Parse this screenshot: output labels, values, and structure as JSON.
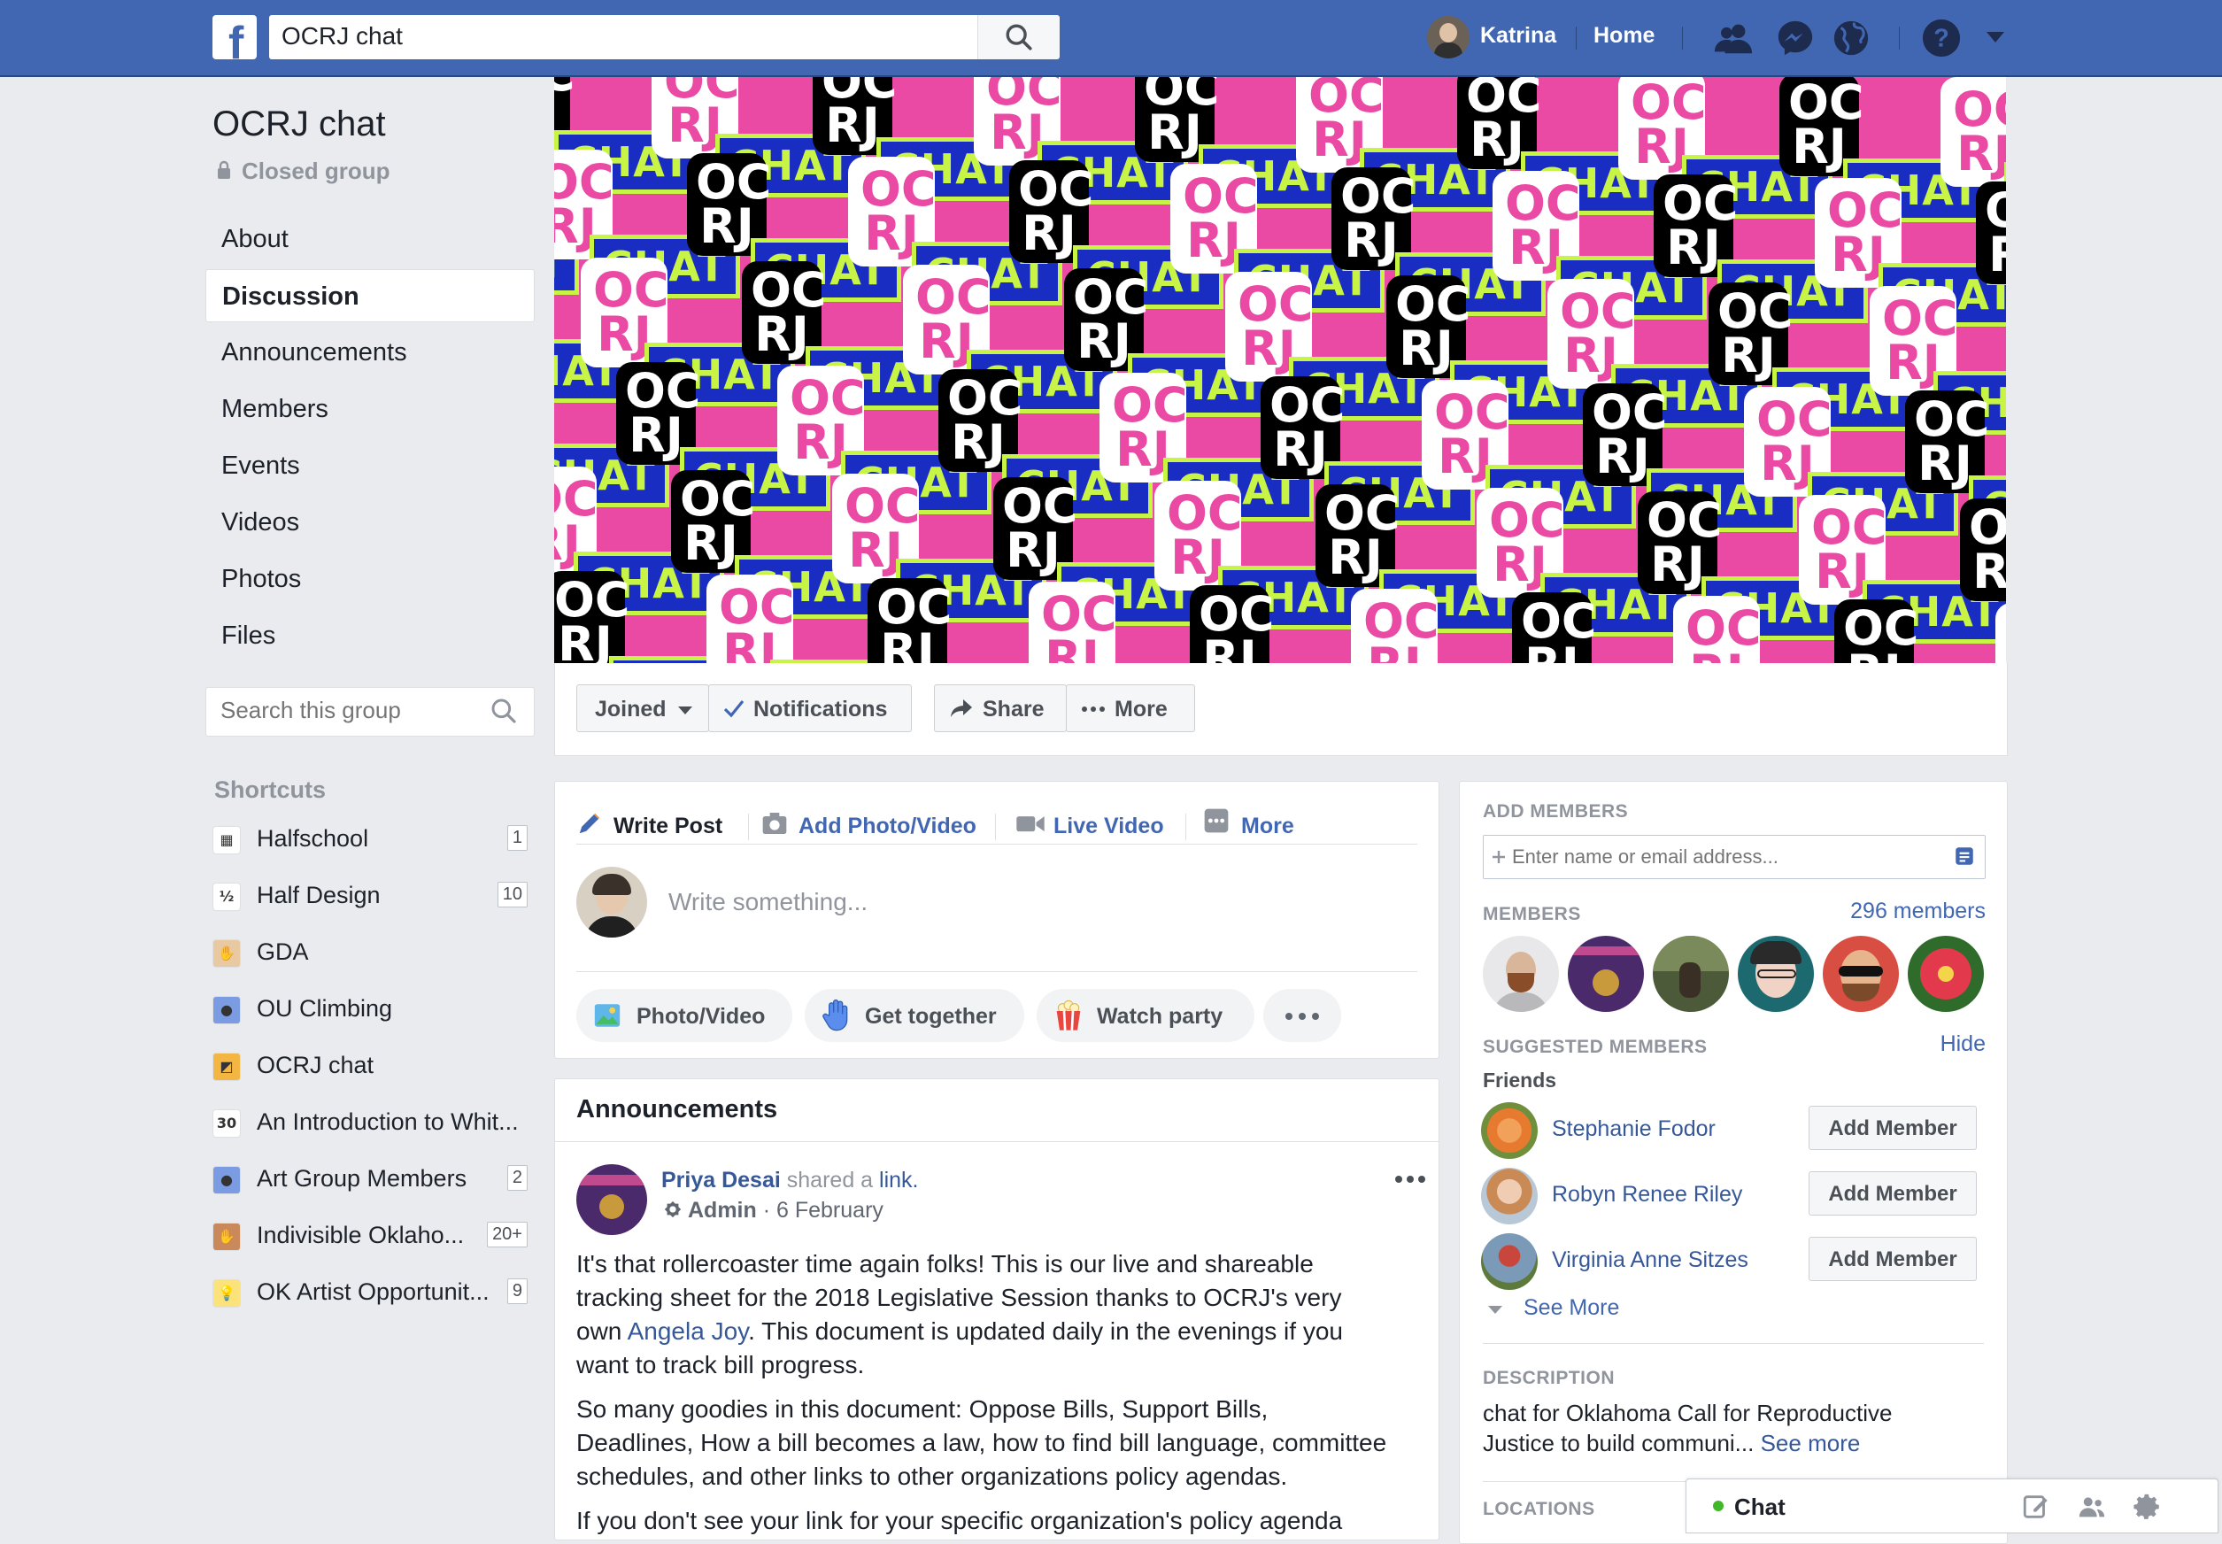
{
  "topbar": {
    "logo": "f",
    "search_value": "OCRJ chat",
    "user_name": "Katrina",
    "home": "Home",
    "icons": [
      "friends-icon",
      "messenger-icon",
      "globe-icon",
      "help-icon",
      "caret-down-icon"
    ]
  },
  "group": {
    "name": "OCRJ chat",
    "privacy": "Closed group"
  },
  "sidebar": {
    "items": [
      {
        "label": "About"
      },
      {
        "label": "Discussion"
      },
      {
        "label": "Announcements"
      },
      {
        "label": "Members"
      },
      {
        "label": "Events"
      },
      {
        "label": "Videos"
      },
      {
        "label": "Photos"
      },
      {
        "label": "Files"
      }
    ],
    "search_placeholder": "Search this group",
    "shortcuts_title": "Shortcuts",
    "shortcuts": [
      {
        "label": "Halfschool",
        "count": "1",
        "color": "#ffffff"
      },
      {
        "label": "Half Design",
        "count": "10",
        "color": "#ffffff"
      },
      {
        "label": "GDA",
        "count": "",
        "color": "#e8c9a1"
      },
      {
        "label": "OU Climbing",
        "count": "",
        "color": "#7b9be3"
      },
      {
        "label": "OCRJ chat",
        "count": "",
        "color": "#f4b642"
      },
      {
        "label": "An Introduction to Whit...",
        "count": "",
        "color": "#ffffff"
      },
      {
        "label": "Art Group Members",
        "count": "2",
        "color": "#7b9be3"
      },
      {
        "label": "Indivisible Oklaho...",
        "count": "20+",
        "color": "#c9895a"
      },
      {
        "label": "OK Artist Opportunit...",
        "count": "9",
        "color": "#fbe27a"
      }
    ]
  },
  "cover": {
    "word_chat": "CHAT",
    "word_oc": "OC",
    "word_rj": "RJ",
    "bg_color": "#ea4aa3"
  },
  "actions": {
    "joined": "Joined",
    "notifications": "Notifications",
    "share": "Share",
    "more": "More"
  },
  "composer": {
    "tabs": [
      "Write Post",
      "Add Photo/Video",
      "Live Video",
      "More"
    ],
    "placeholder": "Write something...",
    "pills": [
      "Photo/Video",
      "Get together",
      "Watch party"
    ]
  },
  "announcements": {
    "title": "Announcements",
    "author": "Priya Desai",
    "shared": "shared a",
    "link": "link.",
    "role": "Admin",
    "date": "· 6 February",
    "p1_a": "It's that rollercoaster time again folks! This is our live and shareable",
    "p1_b": "tracking sheet for the 2018 Legislative Session thanks to OCRJ's very",
    "p1_c_pre": "own ",
    "p1_c_link": "Angela Joy",
    "p1_c_post": ". This document is updated daily in the evenings if you",
    "p1_d": "want to track bill progress.",
    "p2_a": "So many goodies in this document: Oppose Bills, Support Bills,",
    "p2_b": "Deadlines, How a bill becomes a law, how to find bill language, committee",
    "p2_c": "schedules, and other links to other organizations policy agendas.",
    "p3_a": "If you don't see your link for your specific organization's policy agenda"
  },
  "right": {
    "add_members_title": "ADD MEMBERS",
    "add_placeholder": "Enter name or email address...",
    "members_title": "MEMBERS",
    "members_count": "296 members",
    "suggested_title": "SUGGESTED MEMBERS",
    "hide": "Hide",
    "friends": "Friends",
    "suggested": [
      {
        "name": "Stephanie Fodor",
        "btn": "Add Member"
      },
      {
        "name": "Robyn Renee Riley",
        "btn": "Add Member"
      },
      {
        "name": "Virginia Anne Sitzes",
        "btn": "Add Member"
      }
    ],
    "see_more": "See More",
    "description_title": "DESCRIPTION",
    "description_a": "chat for Oklahoma Call for Reproductive",
    "description_b": "Justice to build communi...",
    "description_more": "See more",
    "locations_title": "LOCATIONS"
  },
  "chat": {
    "label": "Chat"
  }
}
